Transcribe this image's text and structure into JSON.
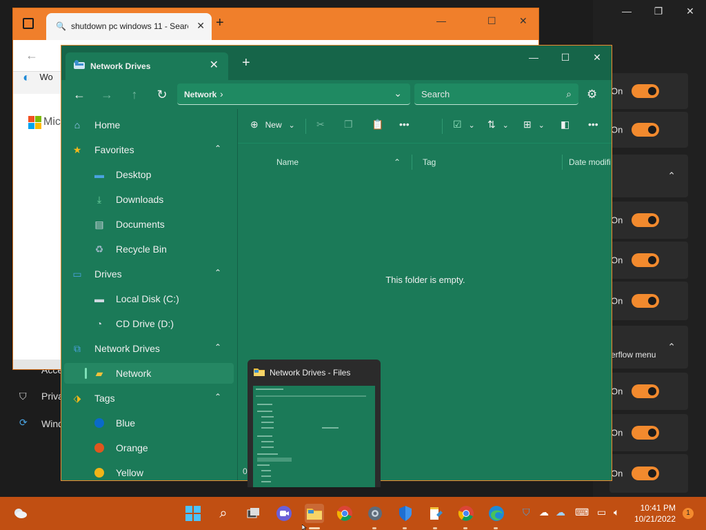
{
  "browser": {
    "tab_title": "shutdown pc windows 11 - Searc",
    "fav_label": "Wo",
    "logo_text": "Mic"
  },
  "settings_bg": {
    "on_label": "On",
    "overflow_label": "erflow menu",
    "left_items": [
      "Acce",
      "Priva",
      "Wind"
    ]
  },
  "files": {
    "tab_label": "Network Drives",
    "breadcrumb": "Network",
    "search_placeholder": "Search",
    "toolbar": {
      "new_label": "New"
    },
    "columns": {
      "name": "Name",
      "tag": "Tag",
      "date": "Date modifi"
    },
    "empty_text": "This folder is empty.",
    "sidebar": [
      {
        "label": "Home",
        "icon": "home-icon",
        "level": 0
      },
      {
        "label": "Favorites",
        "icon": "star-icon",
        "level": 0,
        "expanded": true
      },
      {
        "label": "Desktop",
        "icon": "desktop-icon",
        "level": 1
      },
      {
        "label": "Downloads",
        "icon": "download-icon",
        "level": 1
      },
      {
        "label": "Documents",
        "icon": "document-icon",
        "level": 1
      },
      {
        "label": "Recycle Bin",
        "icon": "recycle-bin-icon",
        "level": 1
      },
      {
        "label": "Drives",
        "icon": "drive-icon",
        "level": 0,
        "expanded": true
      },
      {
        "label": "Local Disk (C:)",
        "icon": "hard-disk-icon",
        "level": 1
      },
      {
        "label": "CD Drive (D:)",
        "icon": "cd-drive-icon",
        "level": 1
      },
      {
        "label": "Network Drives",
        "icon": "network-drive-icon",
        "level": 0,
        "expanded": true
      },
      {
        "label": "Network",
        "icon": "folder-icon",
        "level": 1,
        "selected": true
      },
      {
        "label": "Tags",
        "icon": "tag-icon",
        "level": 0,
        "expanded": true
      },
      {
        "label": "Blue",
        "icon": "tag-dot",
        "level": 1,
        "color": "#0a6ac9"
      },
      {
        "label": "Orange",
        "icon": "tag-dot",
        "level": 1,
        "color": "#e0561e"
      },
      {
        "label": "Yellow",
        "icon": "tag-dot",
        "level": 1,
        "color": "#f2b418"
      }
    ]
  },
  "thumbnail": {
    "title": "Network Drives - Files",
    "count": "0"
  },
  "taskbar": {
    "time": "10:41 PM",
    "date": "10/21/2022",
    "notification_count": "1"
  },
  "colors": {
    "files_bg": "#1b7a58",
    "accent": "#f08a2e",
    "taskbar": "#c14f12"
  }
}
